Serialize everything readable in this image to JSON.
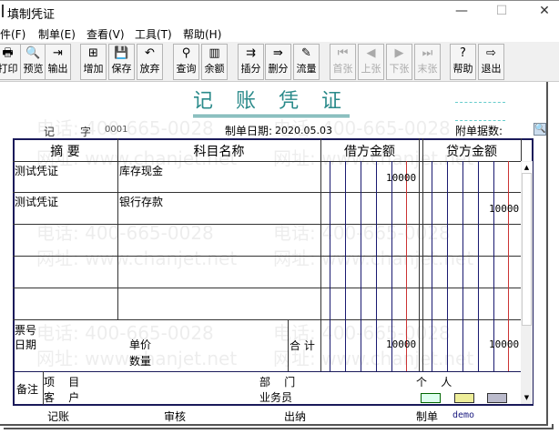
{
  "window": {
    "title": "填制凭证",
    "minimize": "—",
    "maximize": "☐",
    "close": "✕"
  },
  "menu": [
    "文件(F)",
    "制单(E)",
    "查看(V)",
    "工具(T)",
    "帮助(H)"
  ],
  "toolbar": [
    {
      "label": "打印",
      "icon": "print-icon",
      "glyph": "🖶"
    },
    {
      "label": "预览",
      "icon": "preview-icon",
      "glyph": "🔍"
    },
    {
      "label": "输出",
      "icon": "export-icon",
      "glyph": "⇥"
    },
    {
      "label": "增加",
      "icon": "add-icon",
      "glyph": "⊞"
    },
    {
      "label": "保存",
      "icon": "save-icon",
      "glyph": "💾"
    },
    {
      "label": "放弃",
      "icon": "undo-icon",
      "glyph": "↶"
    },
    {
      "label": "查询",
      "icon": "binoculars-icon",
      "glyph": "⚲"
    },
    {
      "label": "余额",
      "icon": "chart-icon",
      "glyph": "▥"
    },
    {
      "label": "插分",
      "icon": "insert-row-icon",
      "glyph": "⇉"
    },
    {
      "label": "删分",
      "icon": "delete-row-icon",
      "glyph": "⇛"
    },
    {
      "label": "流量",
      "icon": "edit-icon",
      "glyph": "✎"
    },
    {
      "label": "首张",
      "icon": "first-icon",
      "glyph": "⏮",
      "disabled": true
    },
    {
      "label": "上张",
      "icon": "prev-icon",
      "glyph": "◀",
      "disabled": true
    },
    {
      "label": "下张",
      "icon": "next-icon",
      "glyph": "▶",
      "disabled": true
    },
    {
      "label": "末张",
      "icon": "last-icon",
      "glyph": "⏭",
      "disabled": true
    },
    {
      "label": "帮助",
      "icon": "help-icon",
      "glyph": "?"
    },
    {
      "label": "退出",
      "icon": "exit-icon",
      "glyph": "⇨"
    }
  ],
  "voucher": {
    "title": "记 账 凭 证",
    "type": "记",
    "zi": "字",
    "number": "0001",
    "date_label": "制单日期:",
    "date": "2020.05.03",
    "attach_label": "附单据数:",
    "headers": {
      "summary": "摘 要",
      "account": "科目名称",
      "debit": "借方金额",
      "credit": "贷方金额"
    },
    "rows": [
      {
        "summary": "测试凭证",
        "account": "库存现金",
        "debit": "10000",
        "credit": ""
      },
      {
        "summary": "测试凭证",
        "account": "银行存款",
        "debit": "",
        "credit": "10000"
      },
      {
        "summary": "",
        "account": "",
        "debit": "",
        "credit": ""
      },
      {
        "summary": "",
        "account": "",
        "debit": "",
        "credit": ""
      },
      {
        "summary": "",
        "account": "",
        "debit": "",
        "credit": ""
      }
    ],
    "totals": {
      "ticket": "票号",
      "date": "日期",
      "price": "单价",
      "qty": "数量",
      "label": "合 计",
      "debit": "10000",
      "credit": "10000"
    },
    "remarks": {
      "label": "备注",
      "project": "项    目",
      "customer": "客    户",
      "dept": "部    门",
      "salesman": "业务员",
      "person": "个    人"
    },
    "footer": {
      "bookkeep": "记账",
      "audit": "审核",
      "cashier": "出纳",
      "maker": "制单",
      "maker_name": "demo"
    }
  },
  "watermark": {
    "phone": "电话: 400-665-0028",
    "site": "网址: www.chanjet.net"
  }
}
